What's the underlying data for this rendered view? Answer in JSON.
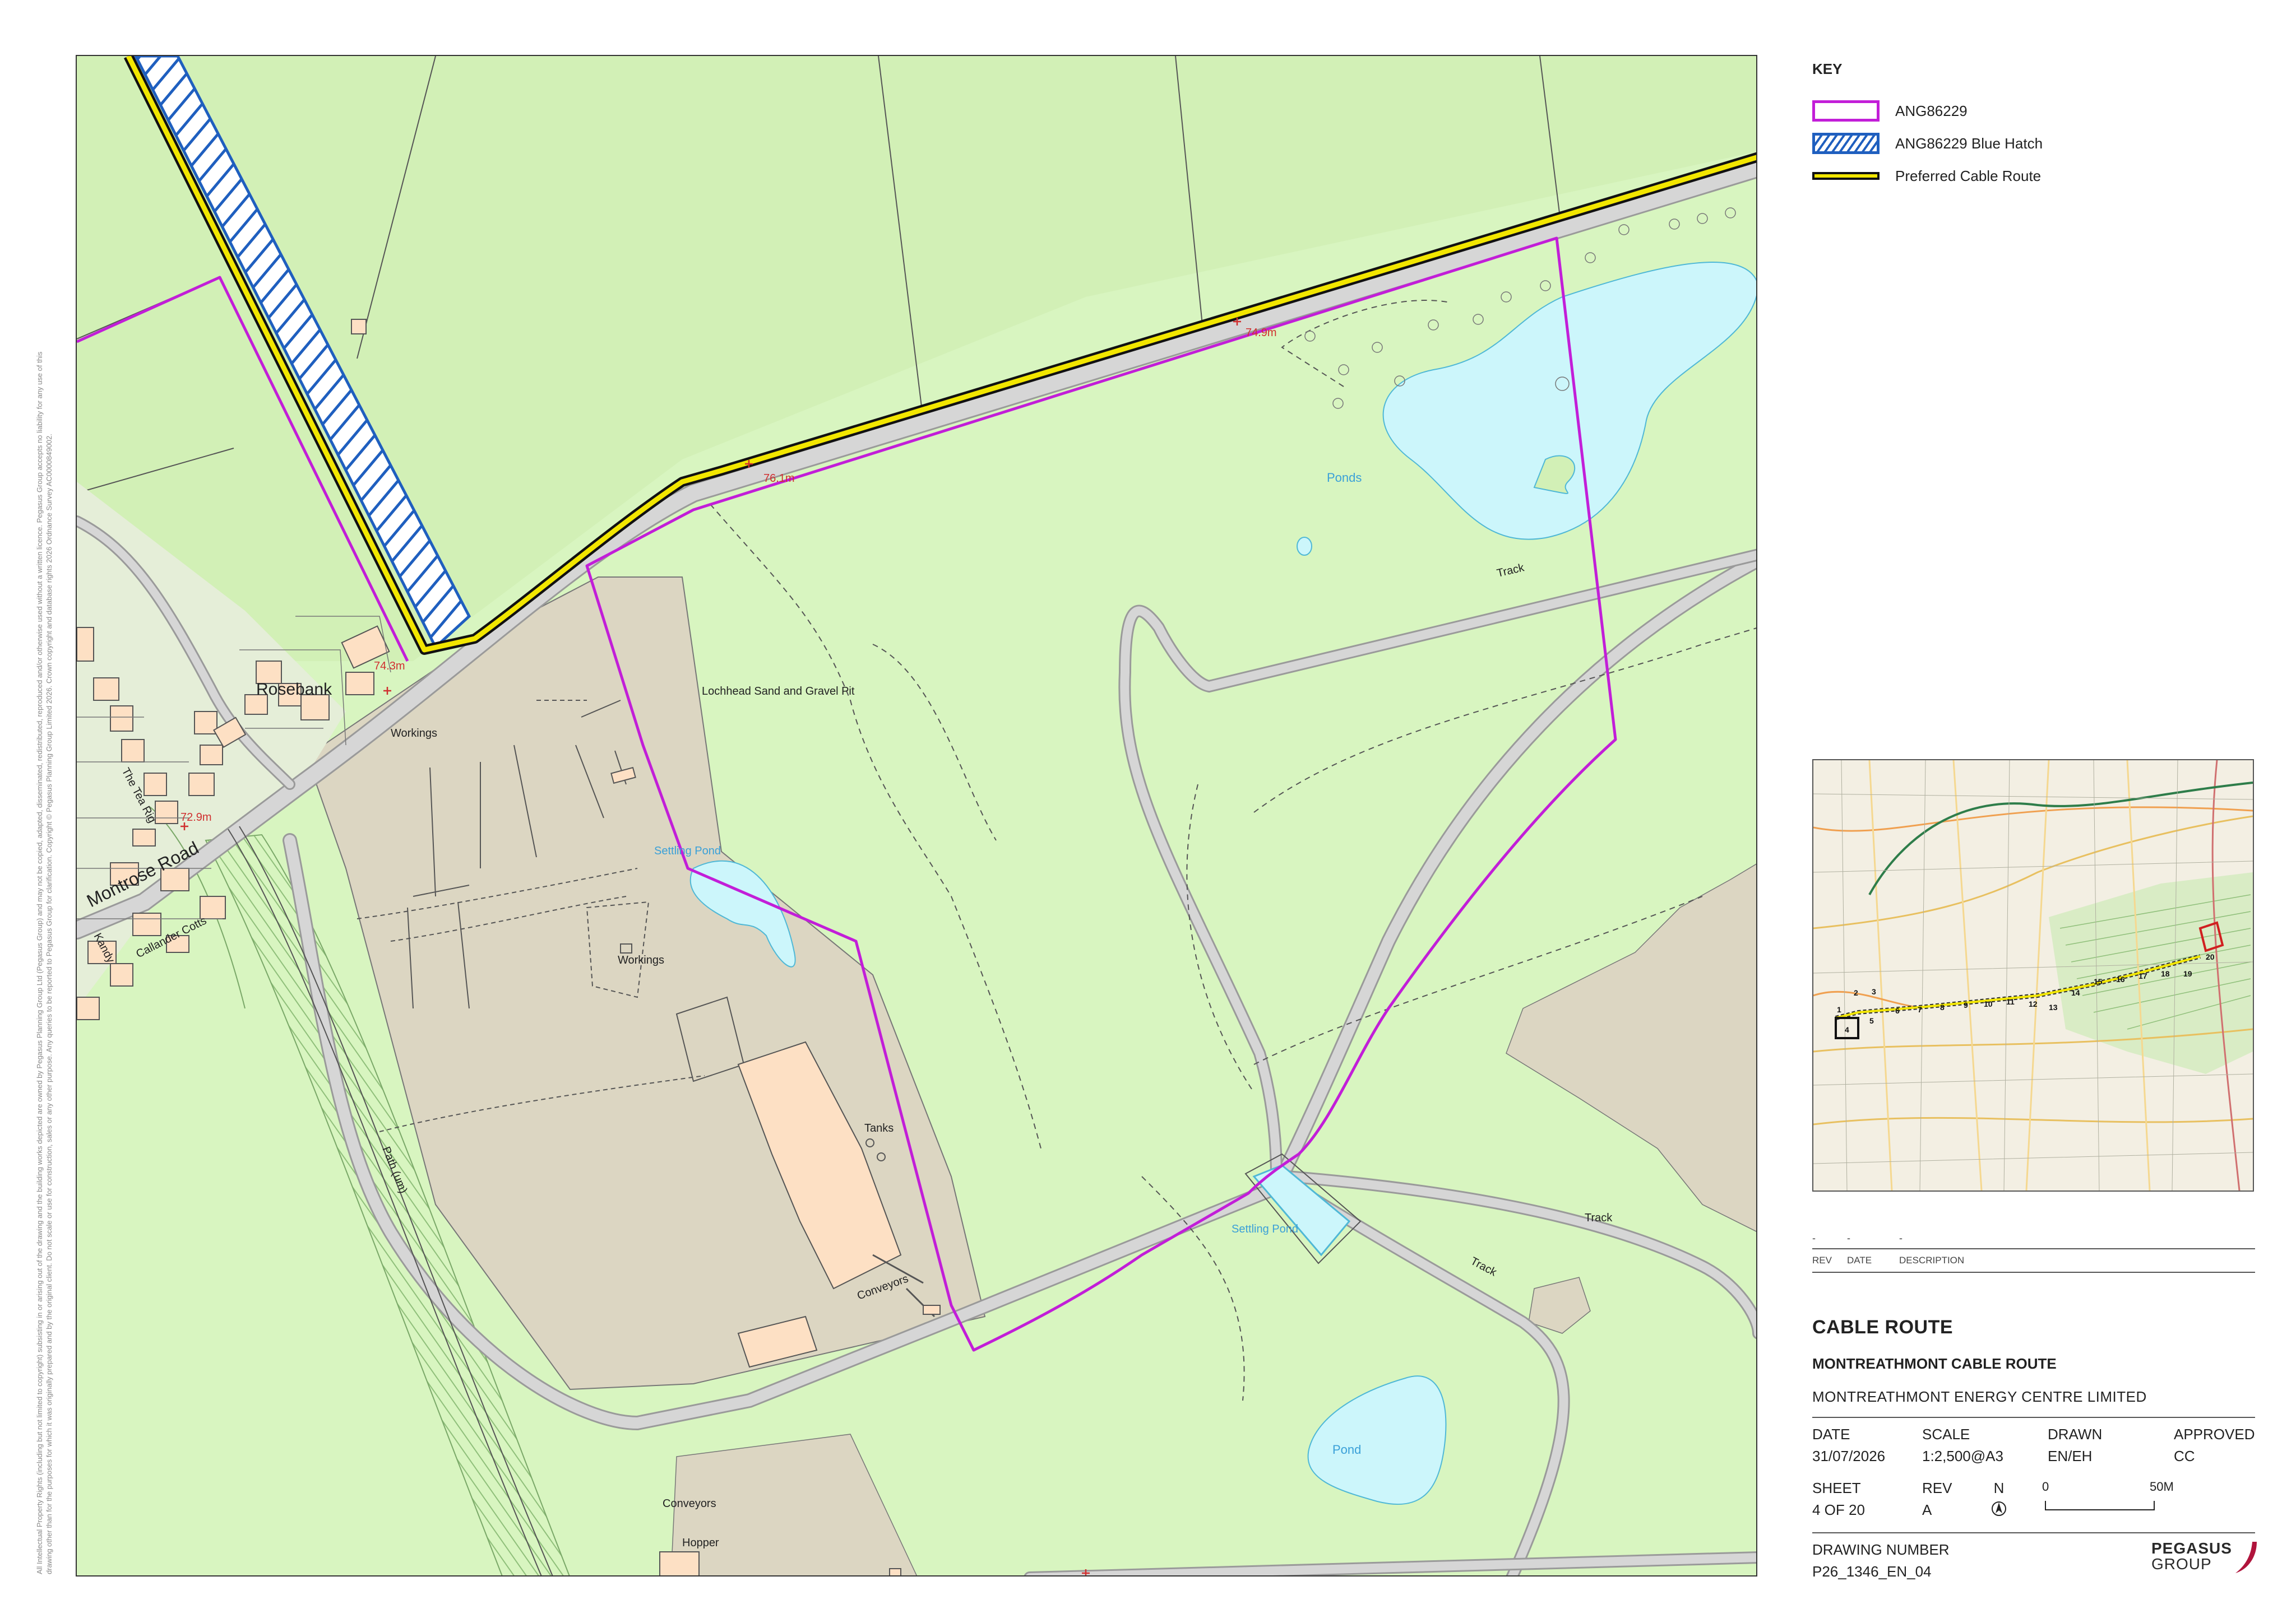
{
  "map": {
    "labels": {
      "rosebank": "Rosebank",
      "montrose_road": "Montrose Road",
      "the_tea_rig": "The Tea Rig",
      "kandy": "Kandy",
      "callander_cotts": "Callander Cotts",
      "workings_1": "Workings",
      "workings_2": "Workings",
      "lochhead": "Lochhead Sand and Gravel Pit",
      "settling_pond_1": "Settling Pond",
      "settling_pond_2": "Settling Pond",
      "ponds": "Ponds",
      "pond": "Pond",
      "track_1": "Track",
      "track_2": "Track",
      "track_3": "Track",
      "tanks": "Tanks",
      "conveyors_1": "Conveyors",
      "conveyors_2": "Conveyors",
      "hopper": "Hopper",
      "path_um": "Path (um)",
      "spot_76": "76.1m",
      "spot_74_9": "74.9m",
      "spot_74_3": "74.3m",
      "spot_72_9": "72.9m"
    }
  },
  "copyright": "All Intellectual Property Rights (including but not limited to copyright) subsisting in or arising out of the drawing and the building works depicted are owned by Pegasus Planning Group Ltd (Pegasus Group) and may not be copied, adapted, disseminated, redistributed, reproduced and/or otherwise used without a written licence. Pegasus Group accepts no liability for any use of this drawing other than for the purposes for which it was originally prepared and by the original client. Do not scale or use for construction, sales or any other purpose. Any queries to be reported to Pegasus Group for clarification. Copyright © Pegasus Planning Group Limited 2026. Crown copyright and database rights 2026 Ordnance Survey AC0000849002.",
  "key": {
    "title": "KEY",
    "items": [
      {
        "label": "ANG86229",
        "style": "outline",
        "color": "#c21ed8"
      },
      {
        "label": "ANG86229 Blue Hatch",
        "style": "hatch",
        "color": "#1f5fbf"
      },
      {
        "label": "Preferred Cable Route",
        "style": "line",
        "color": "#f2e600"
      }
    ]
  },
  "inset": {
    "sheet_numbers": [
      "1",
      "2",
      "3",
      "4",
      "5",
      "6",
      "7",
      "8",
      "9",
      "10",
      "11",
      "12",
      "13",
      "14",
      "15",
      "16",
      "17",
      "18",
      "19",
      "20"
    ]
  },
  "revision": {
    "rev_value": "-",
    "date_value": "-",
    "desc_value": "-",
    "rev_label": "REV",
    "date_label": "DATE",
    "desc_label": "DESCRIPTION"
  },
  "title_block": {
    "title": "CABLE ROUTE",
    "subtitle": "MONTREATHMONT CABLE ROUTE",
    "client": "MONTREATHMONT ENERGY CENTRE LIMITED",
    "date_label": "DATE",
    "date_value": "31/07/2026",
    "scale_label": "SCALE",
    "scale_value": "1:2,500@A3",
    "drawn_label": "DRAWN",
    "drawn_value": "EN/EH",
    "approved_label": "APPROVED",
    "approved_value": "CC",
    "sheet_label": "SHEET",
    "sheet_value": "4 OF 20",
    "rev_label": "REV",
    "rev_value": "A",
    "north_label": "N",
    "scale_start": "0",
    "scale_end": "50",
    "scale_unit": "M",
    "drawing_number_label": "DRAWING NUMBER",
    "drawing_number": "P26_1346_EN_04"
  },
  "logo": {
    "line1": "PEGASUS",
    "line2": "GROUP"
  },
  "colors": {
    "site_boundary": "#c21ed8",
    "hatch": "#1f5fbf",
    "cable_route": "#f2e600",
    "field": "#d8f5c0",
    "quarry": "#dcd6c2",
    "water": "#ccf6fb",
    "building": "#fde0c4"
  }
}
